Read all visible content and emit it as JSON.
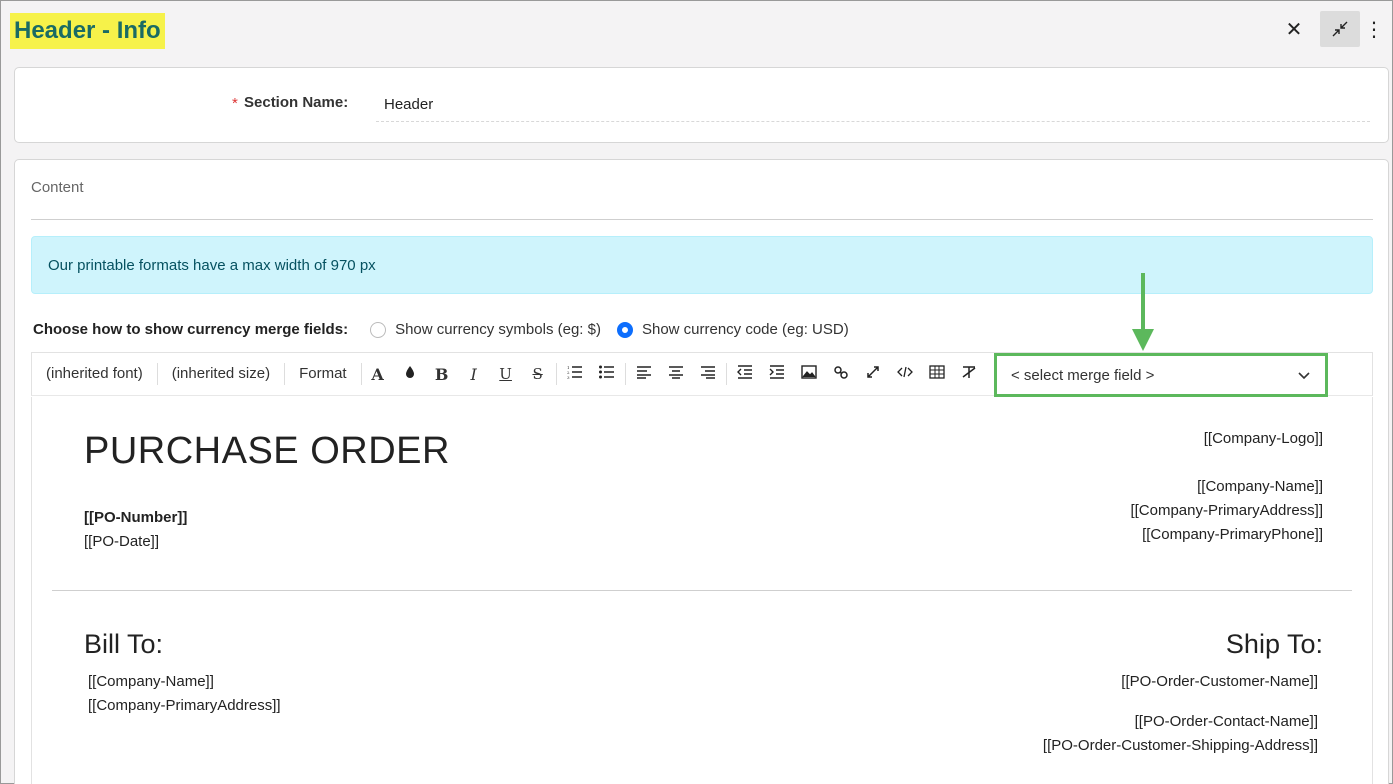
{
  "window": {
    "title": "Header - Info"
  },
  "section": {
    "label": "Section Name:",
    "required_mark": "*",
    "value": "Header"
  },
  "content": {
    "label": "Content",
    "alert": "Our printable formats have a max width of 970 px",
    "currency": {
      "label": "Choose how to show currency merge fields:",
      "options": [
        "Show currency symbols (eg: $)",
        "Show currency code (eg: USD)"
      ],
      "selected_index": 1
    }
  },
  "toolbar": {
    "font": "(inherited font)",
    "size": "(inherited size)",
    "format": "Format",
    "merge_placeholder": "< select merge field >",
    "icons": [
      "font-color-icon",
      "fill-color-icon",
      "bold-icon",
      "italic-icon",
      "underline-icon",
      "strikethrough-icon",
      "ordered-list-icon",
      "unordered-list-icon",
      "align-left-icon",
      "align-center-icon",
      "align-right-icon",
      "outdent-icon",
      "indent-icon",
      "image-icon",
      "link-icon",
      "fullscreen-icon",
      "source-code-icon",
      "table-icon",
      "clear-format-icon"
    ]
  },
  "document": {
    "title": "PURCHASE ORDER",
    "po_number": "[[PO-Number]]",
    "po_date": "[[PO-Date]]",
    "company_logo": "[[Company-Logo]]",
    "company_name": "[[Company-Name]]",
    "company_address": "[[Company-PrimaryAddress]]",
    "company_phone": "[[Company-PrimaryPhone]]",
    "bill_to": "Bill To:",
    "ship_to": "Ship To:",
    "bill_company_name": "[[Company-Name]]",
    "bill_company_address": "[[Company-PrimaryAddress]]",
    "ship_customer_name": "[[PO-Order-Customer-Name]]",
    "ship_contact_name": "[[PO-Order-Contact-Name]]",
    "ship_address": "[[PO-Order-Customer-Shipping-Address]]"
  },
  "colors": {
    "title_highlight": "#f6f24a",
    "title_text": "#1a6b64",
    "accent": "#0d6efd",
    "annotation_green": "#5cb85c",
    "alert_bg": "#cff4fc"
  }
}
